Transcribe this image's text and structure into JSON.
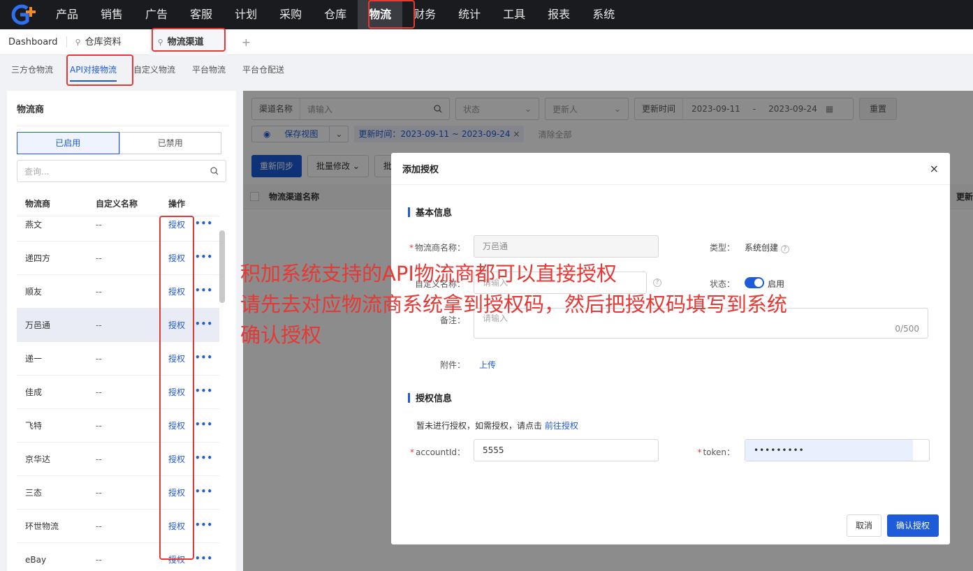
{
  "nav": {
    "items": [
      "产品",
      "销售",
      "广告",
      "客服",
      "计划",
      "采购",
      "仓库",
      "物流",
      "财务",
      "统计",
      "工具",
      "报表",
      "系统"
    ],
    "active_index": 7
  },
  "tabs": {
    "dashboard": "Dashboard",
    "warehouse": "仓库资料",
    "channel": "物流渠道",
    "add": "+"
  },
  "subtabs": [
    "三方仓物流",
    "API对接物流",
    "自定义物流",
    "平台物流",
    "平台仓配送"
  ],
  "left": {
    "title": "物流商",
    "seg_enabled": "已启用",
    "seg_disabled": "已禁用",
    "search_placeholder": "查询...",
    "headers": [
      "物流商",
      "自定义名称",
      "操作"
    ],
    "auth_label": "授权",
    "rows": [
      {
        "name": "燕文",
        "custom": "--"
      },
      {
        "name": "递四方",
        "custom": "--"
      },
      {
        "name": "顺友",
        "custom": "--"
      },
      {
        "name": "万邑通",
        "custom": "--"
      },
      {
        "name": "递一",
        "custom": "--"
      },
      {
        "name": "佳成",
        "custom": "--"
      },
      {
        "name": "飞特",
        "custom": "--"
      },
      {
        "name": "京华达",
        "custom": "--"
      },
      {
        "name": "三态",
        "custom": "--"
      },
      {
        "name": "环世物流",
        "custom": "--"
      },
      {
        "name": "eBay",
        "custom": "--"
      }
    ]
  },
  "right": {
    "filter_channel_label": "渠道名称",
    "filter_channel_placeholder": "请输入",
    "filter_status": "状态",
    "filter_updater": "更新人",
    "filter_time_label": "更新时间",
    "date_start": "2023-09-11",
    "date_sep": "-",
    "date_end": "2023-09-24",
    "reset": "重置",
    "save_view": "保存视图",
    "tag": "更新时间：2023-09-11 ~ 2023-09-24",
    "clear_all": "清除全部",
    "btn_resync": "重新同步",
    "btn_batch": "批量修改",
    "btn_third": "批",
    "col_channel_name": "物流渠道名称",
    "col_update_partial": "更新"
  },
  "modal": {
    "title": "添加授权",
    "section_basic": "基本信息",
    "label_vendor": "物流商名称：",
    "vendor_value": "万邑通",
    "label_type": "类型：",
    "type_value": "系统创建",
    "label_custom": "自定义名称：",
    "custom_placeholder": "请输入",
    "label_status": "状态：",
    "status_value": "启用",
    "label_note": "备注：",
    "note_placeholder": "请输入",
    "note_count": "0/500",
    "label_attach": "附件：",
    "upload": "上传",
    "section_auth": "授权信息",
    "auth_hint": "暂未进行授权，如需授权，请点击",
    "auth_link": "前往授权",
    "label_account": "accountId：",
    "account_value": "5555",
    "label_token": "token：",
    "token_value": "•••••••••",
    "cancel": "取消",
    "confirm": "确认授权"
  },
  "annotation": {
    "line1": "积加系统支持的API物流商都可以直接授权",
    "line2": "请先去对应物流商系统拿到授权码，然后把授权码填写到系统",
    "line3": "确认授权"
  },
  "colors": {
    "accent": "#1d5bd8",
    "annotation": "#e53935",
    "nav_bg": "#1a1b1f"
  }
}
